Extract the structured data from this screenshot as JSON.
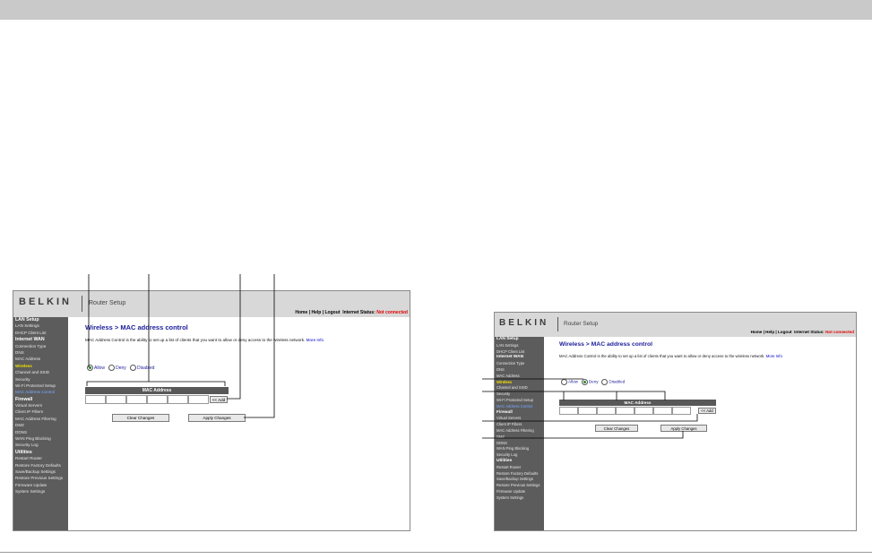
{
  "panels": [
    {
      "brand": "BELKIN",
      "app_title": "Router Setup",
      "top_links": "Home | Help | Logout",
      "internet_status_label": "Internet Status:",
      "internet_status_value": "Not connected",
      "page_title": "Wireless > MAC address control",
      "description": "MAC Address Control is the ability to set up a list of clients that you want to allow or deny access to the wireless network.",
      "more_info": "More Info",
      "radios": [
        {
          "label": "Allow",
          "checked": true
        },
        {
          "label": "Deny",
          "checked": false
        },
        {
          "label": "Disabled",
          "checked": false
        }
      ],
      "mac_header": "MAC Address",
      "add_button": "<< Add",
      "clear_button": "Clear Changes",
      "apply_button": "Apply Changes"
    },
    {
      "brand": "BELKIN",
      "app_title": "Router Setup",
      "top_links": "Home | Help | Logout",
      "internet_status_label": "Internet Status:",
      "internet_status_value": "Not connected",
      "page_title": "Wireless > MAC address control",
      "description": "MAC Address Control is the ability to set up a list of clients that you want to allow or deny access to the wireless network.",
      "more_info": "More Info",
      "radios": [
        {
          "label": "Allow",
          "checked": false
        },
        {
          "label": "Deny",
          "checked": true
        },
        {
          "label": "Disabled",
          "checked": false
        }
      ],
      "mac_header": "MAC Address",
      "add_button": "<< Add",
      "clear_button": "Clear Changes",
      "apply_button": "Apply Changes"
    }
  ],
  "sidebar": [
    {
      "label": "LAN Setup",
      "kind": "section"
    },
    {
      "label": "LAN Settings",
      "kind": "item"
    },
    {
      "label": "DHCP Client List",
      "kind": "item"
    },
    {
      "label": "Internet WAN",
      "kind": "section"
    },
    {
      "label": "Connection Type",
      "kind": "item"
    },
    {
      "label": "DNS",
      "kind": "item"
    },
    {
      "label": "MAC Address",
      "kind": "item"
    },
    {
      "label": "Wireless",
      "kind": "section-active"
    },
    {
      "label": "Channel and SSID",
      "kind": "item"
    },
    {
      "label": "Security",
      "kind": "item"
    },
    {
      "label": "Wi-Fi Protected Setup",
      "kind": "item"
    },
    {
      "label": "MAC Address Control",
      "kind": "item-active"
    },
    {
      "label": "Firewall",
      "kind": "section"
    },
    {
      "label": "Virtual Servers",
      "kind": "item"
    },
    {
      "label": "Client IP Filters",
      "kind": "item"
    },
    {
      "label": "MAC Address Filtering",
      "kind": "item"
    },
    {
      "label": "DMZ",
      "kind": "item"
    },
    {
      "label": "DDNS",
      "kind": "item"
    },
    {
      "label": "WAN Ping Blocking",
      "kind": "item"
    },
    {
      "label": "Security Log",
      "kind": "item"
    },
    {
      "label": "Utilities",
      "kind": "section"
    },
    {
      "label": "Restart Router",
      "kind": "item"
    },
    {
      "label": "Restore Factory Defaults",
      "kind": "item"
    },
    {
      "label": "Save/Backup Settings",
      "kind": "item"
    },
    {
      "label": "Restore Previous Settings",
      "kind": "item"
    },
    {
      "label": "Firmware Update",
      "kind": "item"
    },
    {
      "label": "System Settings",
      "kind": "item"
    }
  ]
}
